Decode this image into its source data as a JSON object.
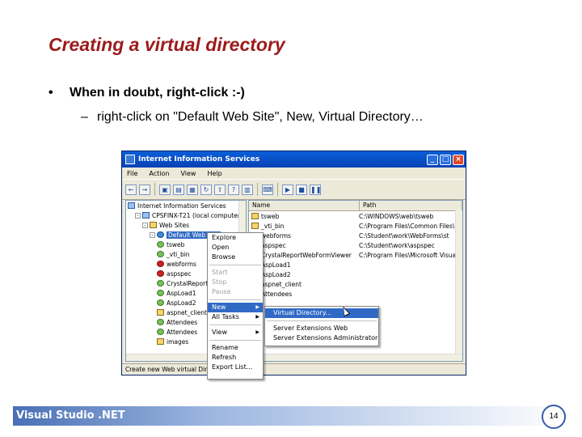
{
  "slide": {
    "title": "Creating a virtual directory",
    "bullet1": "When in doubt, right-click :-)",
    "bullet2": "right-click on \"Default Web Site\", New, Virtual Directory…",
    "footer": "Visual Studio .NET",
    "page_number": "14"
  },
  "window": {
    "title": "Internet Information Services",
    "menu": [
      "File",
      "Action",
      "View",
      "Help"
    ],
    "tree": [
      {
        "label": "Internet Information Services",
        "icon": "iis-icon",
        "indent": 0
      },
      {
        "label": "CPSFINX-T21 (local computer)",
        "icon": "computer-icon",
        "indent": 1
      },
      {
        "label": "Web Sites",
        "icon": "folder-icon",
        "indent": 2
      },
      {
        "label": "Default Web Site",
        "icon": "globe-icon",
        "indent": 3,
        "selected": true
      },
      {
        "label": "tsweb",
        "icon": "gear-icon",
        "indent": 4
      },
      {
        "label": "_vti_bin",
        "icon": "gear-icon",
        "indent": 4
      },
      {
        "label": "webforms",
        "icon": "stop-icon",
        "indent": 4
      },
      {
        "label": "aspspec",
        "icon": "stop-icon",
        "indent": 4
      },
      {
        "label": "CrystalReport",
        "icon": "gear-icon",
        "indent": 4
      },
      {
        "label": "AspLoad1",
        "icon": "gear-icon",
        "indent": 4
      },
      {
        "label": "AspLoad2",
        "icon": "gear-icon",
        "indent": 4
      },
      {
        "label": "aspnet_client",
        "icon": "folder-icon",
        "indent": 4
      },
      {
        "label": "Attendees",
        "icon": "gear-icon",
        "indent": 4
      },
      {
        "label": "Attendees",
        "icon": "gear-icon",
        "indent": 4
      },
      {
        "label": "images",
        "icon": "folder-icon",
        "indent": 4
      }
    ],
    "list_headers": {
      "name": "Name",
      "path": "Path"
    },
    "list_rows": [
      {
        "name": "tsweb",
        "path": "C:\\WINDOWS\\web\\tsweb"
      },
      {
        "name": "_vti_bin",
        "path": "C:\\Program Files\\Common Files\\"
      },
      {
        "name": "webforms",
        "path": "C:\\Student\\work\\WebForms\\st"
      },
      {
        "name": "aspspec",
        "path": "C:\\Student\\work\\aspspec"
      },
      {
        "name": "CrystalReportWebFormViewer",
        "path": "C:\\Program Files\\Microsoft Visua"
      },
      {
        "name": "AspLoad1",
        "path": ""
      },
      {
        "name": "AspLoad2",
        "path": ""
      },
      {
        "name": "aspnet_client",
        "path": ""
      },
      {
        "name": "Attendees",
        "path": ""
      }
    ],
    "status": "Create new Web virtual Directory"
  },
  "context_menu": {
    "items": [
      {
        "label": "Explore",
        "disabled": false
      },
      {
        "label": "Open",
        "disabled": false
      },
      {
        "label": "Browse",
        "disabled": false
      },
      {
        "sep": true
      },
      {
        "label": "Start",
        "disabled": true
      },
      {
        "label": "Stop",
        "disabled": true
      },
      {
        "label": "Pause",
        "disabled": true
      },
      {
        "sep": true
      },
      {
        "label": "New",
        "submenu": true,
        "highlighted": true
      },
      {
        "label": "All Tasks",
        "submenu": true
      },
      {
        "sep": true
      },
      {
        "label": "View",
        "submenu": true
      },
      {
        "sep": true
      },
      {
        "label": "Rename"
      },
      {
        "label": "Refresh"
      },
      {
        "label": "Export List..."
      }
    ],
    "submenu": [
      {
        "label": "Virtual Directory...",
        "highlighted": true
      },
      {
        "sep": true
      },
      {
        "label": "Server Extensions Web"
      },
      {
        "label": "Server Extensions Administrator"
      }
    ]
  },
  "colors": {
    "title": "#9b1b1b",
    "highlight": "#316ac5",
    "titlebar": "#0a5fd8"
  }
}
